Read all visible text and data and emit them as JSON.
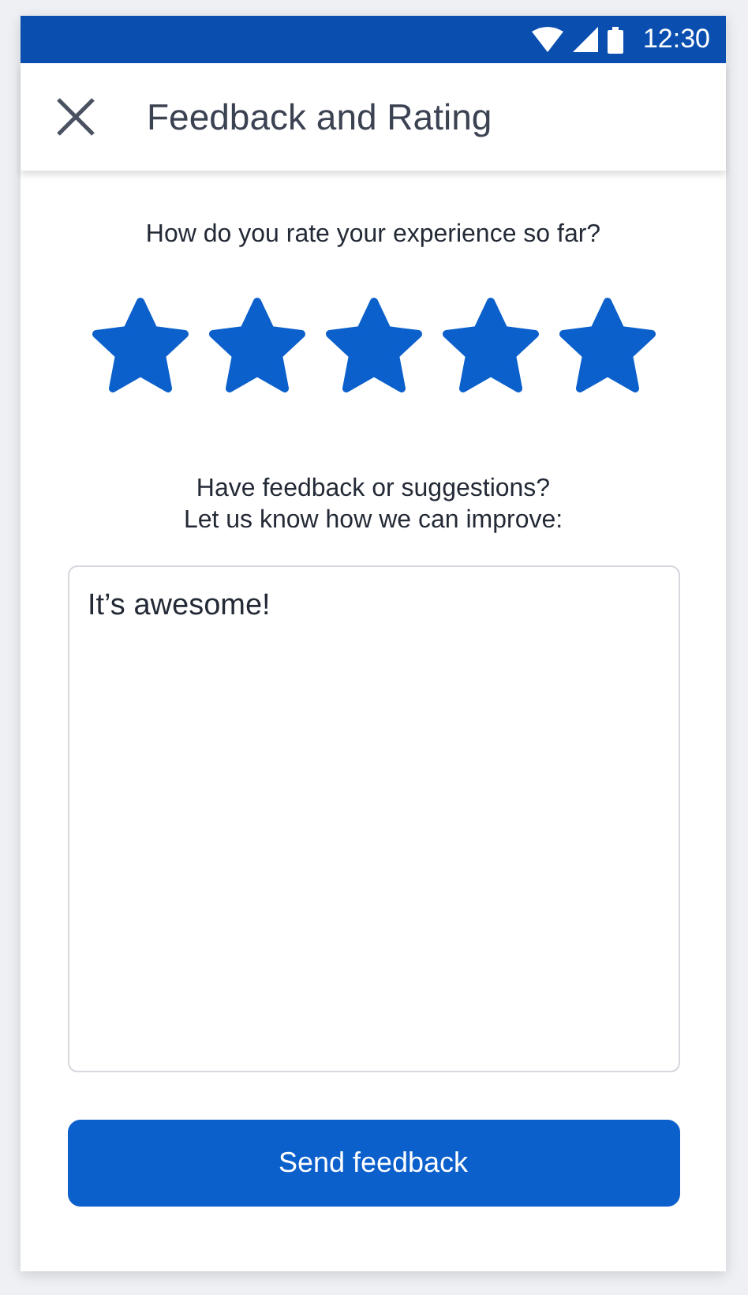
{
  "status_bar": {
    "time": "12:30"
  },
  "app_bar": {
    "title": "Feedback and Rating"
  },
  "rating": {
    "question": "How do you rate your experience so far?",
    "stars": 5
  },
  "feedback": {
    "prompt": "Have feedback or suggestions?\nLet us know how we can improve:",
    "value": "It’s awesome!"
  },
  "submit_button": {
    "label": "Send feedback"
  }
}
